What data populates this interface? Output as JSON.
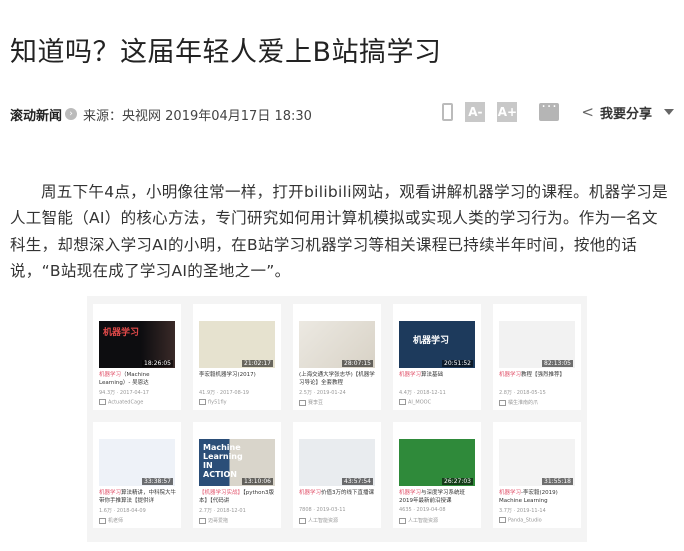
{
  "article": {
    "title": "知道吗？这届年轻人爱上B站搞学习",
    "source_name": "滚动新闻",
    "source_line": "来源：央视网 2019年04月17日 18:30",
    "font_smaller": "A-",
    "font_larger": "A+",
    "share_label": "我要分享",
    "paragraph": "周五下午4点，小明像往常一样，打开bilibili网站，观看讲解机器学习的课程。机器学习是人工智能（AI）的核心方法，专门研究如何用计算机模拟或实现人类的学习行为。作为一名文科生，却想深入学习AI的小明，在B站学习机器学习等相关课程已持续半年时间，按他的话说，“B站现在成了学习AI的圣地之一”。"
  },
  "icons": {
    "go": "circle-arrow-icon",
    "phone": "mobile-phone-icon",
    "comment": "comment-icon",
    "share": "share-icon",
    "caret": "chevron-down-icon"
  },
  "colors": {
    "highlight": "#e2546c"
  },
  "videos": [
    {
      "duration": "18:26:05",
      "title_hl": "机器学习",
      "title_rest": "（Machine Learning）- 吴恩达",
      "stats": "94.3万 · 2017-04-17",
      "uploader": "ActuatedCage",
      "thumb_text": "机器学习"
    },
    {
      "duration": "21:02:17",
      "title_hl": "",
      "title_rest": "李宏毅机器学习(2017)",
      "stats": "41.9万 · 2017-08-19",
      "uploader": "fly51fly",
      "thumb_text": ""
    },
    {
      "duration": "28:07:15",
      "title_hl": "",
      "title_rest": "(上海交通大学张志华)【机器学习导论】全套教程",
      "stats": "2.5万 · 2019-01-24",
      "uploader": "赛李豆",
      "thumb_text": ""
    },
    {
      "duration": "20:51:52",
      "title_hl": "机器学习",
      "title_rest": "算法基础",
      "stats": "4.4万 · 2018-12-11",
      "uploader": "AI_MOOC",
      "thumb_text": "机器学习"
    },
    {
      "duration": "82:13:05",
      "title_hl": "机器学习",
      "title_rest": "教程【强烈推荐】",
      "stats": "2.8万 · 2018-05-15",
      "uploader": "橘生淮南的爪",
      "thumb_text": ""
    },
    {
      "duration": "33:38:57",
      "title_hl": "机器学习",
      "title_rest": "算法精讲，中科院大牛带你手推算法【提供详",
      "stats": "1.6万 · 2018-04-09",
      "uploader": "机老师",
      "thumb_text": ""
    },
    {
      "duration": "13:10:06",
      "title_hl": "【机器学习实战】",
      "title_rest": "【python3版本】【代码讲",
      "stats": "2.7万 · 2018-12-01",
      "uploader": "迈哥爱拖",
      "thumb_text": "Machine Learning IN ACTION"
    },
    {
      "duration": "43:57:54",
      "title_hl": "机器学习",
      "title_rest": "价值3万的线下直播课",
      "stats": "7808 · 2019-03-11",
      "uploader": "人工智能资源",
      "thumb_text": ""
    },
    {
      "duration": "26:27:03",
      "title_hl": "机器学习",
      "title_rest": "与深度学习系统班2019年最新前沿授课",
      "stats": "4635 · 2019-04-08",
      "uploader": "人工智能资源",
      "thumb_text": ""
    },
    {
      "duration": "31:55:18",
      "title_hl": "机器学习",
      "title_rest": "-李宏毅(2019) Machine Learning",
      "stats": "3.7万 · 2019-11-14",
      "uploader": "Panda_Studio",
      "thumb_text": ""
    }
  ]
}
